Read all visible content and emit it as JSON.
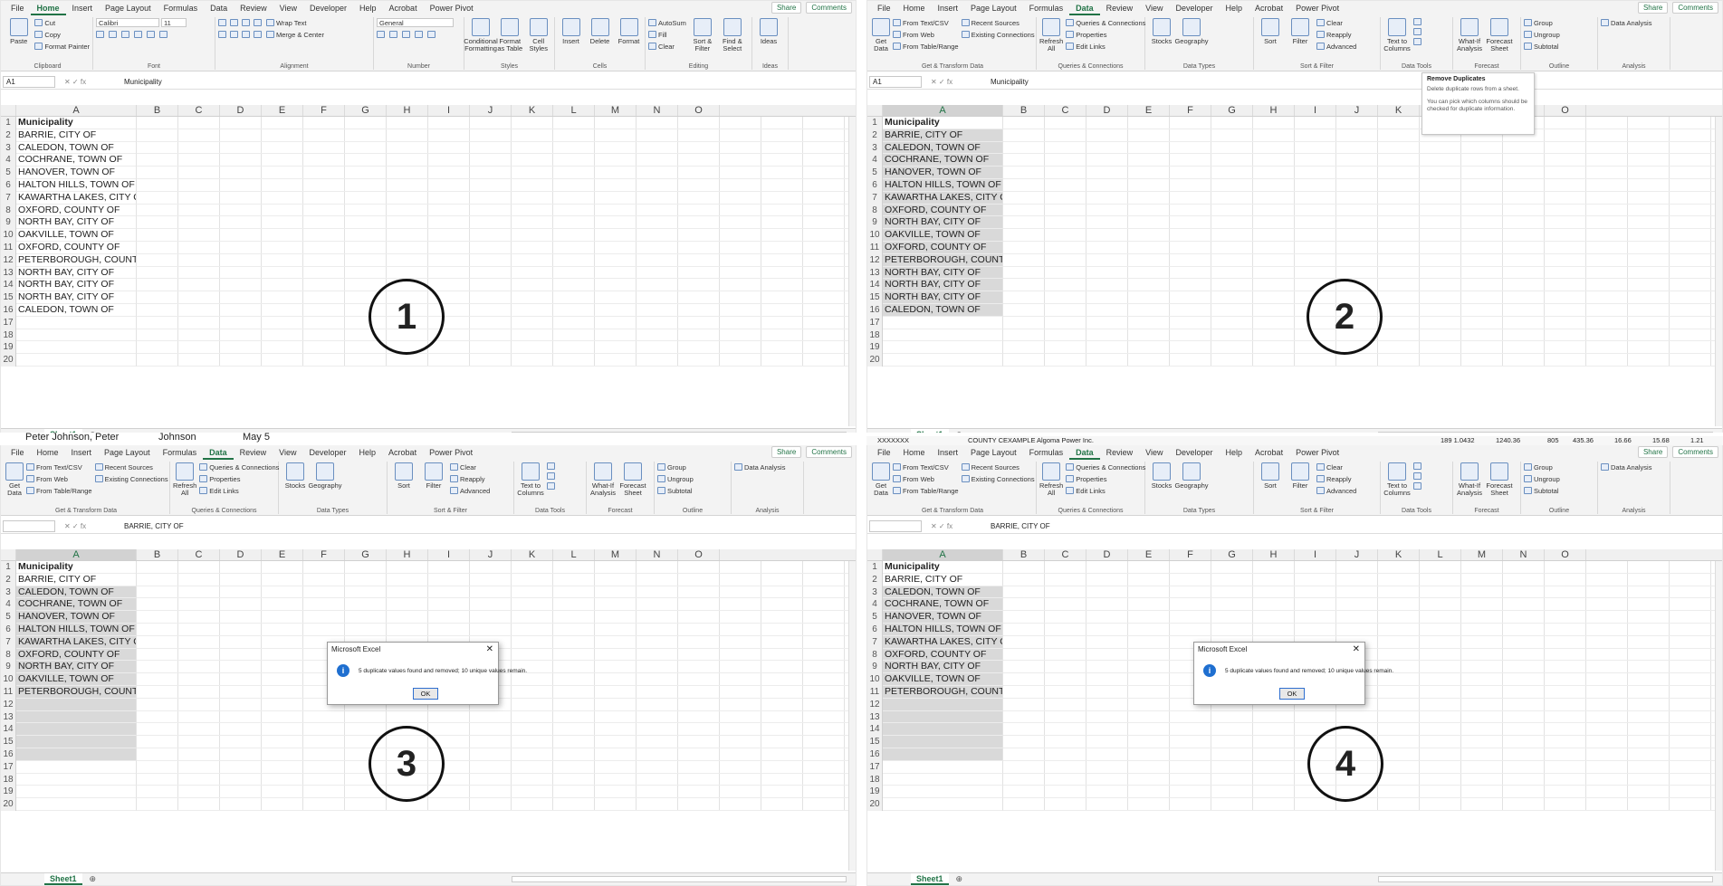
{
  "tabs": [
    "File",
    "Home",
    "Insert",
    "Page Layout",
    "Formulas",
    "Data",
    "Review",
    "View",
    "Developer",
    "Help",
    "Acrobat",
    "Power Pivot"
  ],
  "share_label": "Share",
  "comments_label": "Comments",
  "home_ribbon": {
    "clipboard": {
      "paste": "Paste",
      "cut": "Cut",
      "copy": "Copy",
      "format_painter": "Format Painter",
      "label": "Clipboard"
    },
    "font": {
      "name": "Calibri",
      "size": "11",
      "label": "Font"
    },
    "alignment": {
      "wrap": "Wrap Text",
      "merge": "Merge & Center",
      "label": "Alignment"
    },
    "number": {
      "format": "General",
      "label": "Number"
    },
    "styles": {
      "cond": "Conditional Formatting",
      "table": "Format as Table",
      "cell": "Cell Styles",
      "label": "Styles"
    },
    "cells": {
      "insert": "Insert",
      "delete": "Delete",
      "format": "Format",
      "label": "Cells"
    },
    "editing": {
      "autosum": "AutoSum",
      "fill": "Fill",
      "clear": "Clear",
      "sort": "Sort & Filter",
      "find": "Find & Select",
      "label": "Editing"
    },
    "ideas": {
      "ideas": "Ideas",
      "label": "Ideas"
    }
  },
  "data_ribbon": {
    "get": {
      "get_data": "Get Data",
      "text_csv": "From Text/CSV",
      "web": "From Web",
      "table": "From Table/Range",
      "recent": "Recent Sources",
      "existing": "Existing Connections",
      "label": "Get & Transform Data"
    },
    "queries": {
      "refresh": "Refresh All",
      "qc": "Queries & Connections",
      "props": "Properties",
      "edit": "Edit Links",
      "label": "Queries & Connections"
    },
    "types": {
      "stocks": "Stocks",
      "geo": "Geography",
      "label": "Data Types"
    },
    "sort": {
      "sort": "Sort",
      "filter": "Filter",
      "clear": "Clear",
      "reapply": "Reapply",
      "advanced": "Advanced",
      "label": "Sort & Filter"
    },
    "tools": {
      "text_cols": "Text to Columns",
      "label": "Data Tools"
    },
    "forecast": {
      "whatif": "What-If Analysis",
      "sheet": "Forecast Sheet",
      "label": "Forecast"
    },
    "outline": {
      "group": "Group",
      "ungroup": "Ungroup",
      "subtotal": "Subtotal",
      "label": "Outline"
    },
    "analysis": {
      "da": "Data Analysis",
      "label": "Analysis"
    }
  },
  "formula_bar": {
    "p1": {
      "name": "A1",
      "content": "Municipality"
    },
    "p2": {
      "name": "A1",
      "content": "Municipality"
    },
    "p3": {
      "name": "",
      "content": "BARRIE, CITY OF"
    },
    "p4": {
      "name": "",
      "content": "BARRIE, CITY OF"
    }
  },
  "columns": [
    "A",
    "B",
    "C",
    "D",
    "E",
    "F",
    "G",
    "H",
    "I",
    "J",
    "K",
    "L",
    "M",
    "N",
    "O"
  ],
  "rows_before": [
    "Municipality",
    "BARRIE, CITY OF",
    "CALEDON, TOWN OF",
    "COCHRANE, TOWN OF",
    "HANOVER, TOWN OF",
    "HALTON HILLS, TOWN OF",
    "KAWARTHA LAKES, CITY OF",
    "OXFORD, COUNTY OF",
    "NORTH BAY, CITY OF",
    "OAKVILLE, TOWN OF",
    "OXFORD, COUNTY OF",
    "PETERBOROUGH, COUNTY OF",
    "NORTH BAY, CITY OF",
    "NORTH BAY, CITY OF",
    "NORTH BAY, CITY OF",
    "CALEDON, TOWN OF",
    "",
    "",
    "",
    ""
  ],
  "rows_after": [
    "Municipality",
    "BARRIE, CITY OF",
    "CALEDON, TOWN OF",
    "COCHRANE, TOWN OF",
    "HANOVER, TOWN OF",
    "HALTON HILLS, TOWN OF",
    "KAWARTHA LAKES, CITY OF",
    "OXFORD, COUNTY OF",
    "NORTH BAY, CITY OF",
    "OAKVILLE, TOWN OF",
    "PETERBOROUGH, COUNTY OF",
    "",
    "",
    "",
    "",
    "",
    "",
    "",
    "",
    ""
  ],
  "steps": [
    "1",
    "2",
    "3",
    "4"
  ],
  "sheet_tab": "Sheet1",
  "tooltip": {
    "title": "Remove Duplicates",
    "line1": "Delete duplicate rows from a sheet.",
    "line2": "You can pick which columns should be checked for duplicate information."
  },
  "dialog": {
    "title": "Microsoft Excel",
    "message": "5 duplicate values found and removed; 10 unique values remain.",
    "ok": "OK"
  },
  "strip": {
    "a": "Peter Johnson, Peter",
    "b": "Johnson",
    "c": "May 5",
    "d": "XXXXXXX",
    "e": "COUNTY CEXAMPLE",
    "f": "Algoma Power Inc.",
    "g": "189  1.0432",
    "h": "1240.36",
    "i": "805",
    "j": "435.36",
    "k": "16.66",
    "l": "15.68",
    "m": "1.21"
  }
}
